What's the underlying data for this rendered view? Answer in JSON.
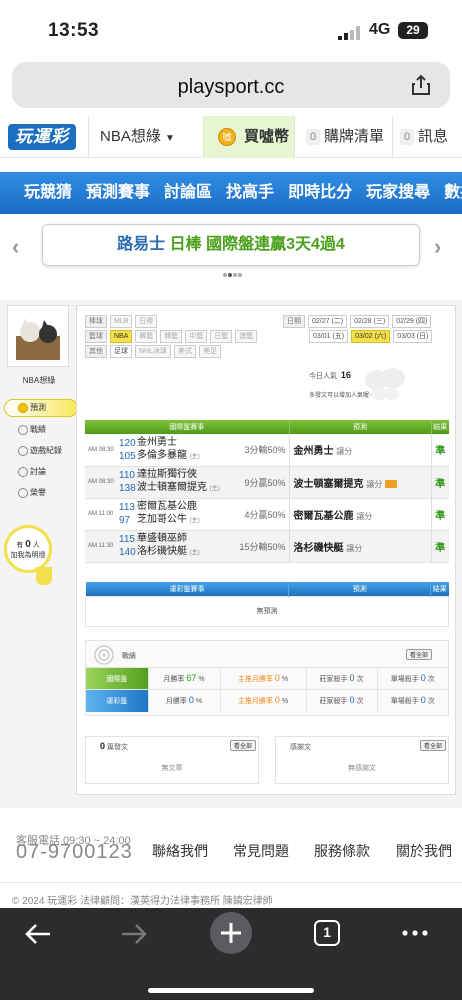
{
  "status": {
    "time": "13:53",
    "network": "4G",
    "battery": "29"
  },
  "browser": {
    "host": "playsport.cc",
    "tab_count": "1"
  },
  "nav1": {
    "logo": "玩運彩",
    "channel": "NBA想綠",
    "coin": "買噓幣",
    "buy_list": "購牌清單",
    "messages": "訊息",
    "buy_count": "0",
    "msg_count": "0"
  },
  "nav2": {
    "items": [
      "玩競猜",
      "預測賽事",
      "討論區",
      "找高手",
      "即時比分",
      "玩家搜尋",
      "數據"
    ]
  },
  "banner": {
    "part1": "路易士",
    "part2": "日棒",
    "part3": "國際盤連贏3天4過4"
  },
  "sidebar": {
    "name": "NBA想綠",
    "menu": [
      "預測",
      "戰績",
      "遊戲紀錄",
      "討論",
      "榮譽"
    ],
    "like_prefix": "有",
    "like_count": "0",
    "like_suffix": "人",
    "like_line2": "加我為明燈"
  },
  "filters": {
    "label_ball": "棒球",
    "label_basket": "籃球",
    "label_other": "其他",
    "label_date": "日期",
    "ball": [
      "MLB",
      "日棒"
    ],
    "basket": [
      "NBA",
      "韓籃",
      "韓籃",
      "中籃",
      "日籃",
      "澳籃"
    ],
    "other": [
      "足球",
      "NHL冰球",
      "美式",
      "美足"
    ],
    "dates1": [
      "02/27 (二)",
      "02/28 (三)",
      "02/29 (四)"
    ],
    "dates2": [
      "03/01 (五)",
      "03/02 (六)",
      "03/03 (日)"
    ],
    "today_label": "今日人氣",
    "today_count": "16",
    "note": "多發文可以增加人氣喔~"
  },
  "table": {
    "h_game": "國際盤賽事",
    "h_pred": "預測",
    "h_res": "結果",
    "rows": [
      {
        "time": "AM 08:30",
        "n1": "120",
        "t1": "金州勇士",
        "n2": "105",
        "t2": "多倫多暴龍",
        "t2tag": "(主)",
        "odds": "3分輸50%",
        "pred": "金州勇士",
        "ptype": "讓分",
        "res": "準"
      },
      {
        "time": "AM 08:30",
        "n1": "110",
        "t1": "達拉斯獨行俠",
        "n2": "138",
        "t2": "波士頓塞爾提克",
        "t2tag": "(主)",
        "odds": "9分贏50%",
        "pred": "波士頓塞爾提克",
        "ptype": "讓分",
        "res": "準"
      },
      {
        "time": "AM 11:00",
        "n1": "113",
        "t1": "密爾瓦基公鹿",
        "n2": "97",
        "t2": "芝加哥公牛",
        "t2tag": "(主)",
        "odds": "4分贏50%",
        "pred": "密爾瓦基公鹿",
        "ptype": "讓分",
        "res": "準"
      },
      {
        "time": "AM 11:30",
        "n1": "115",
        "t1": "華盛頓巫師",
        "n2": "140",
        "t2": "洛杉磯快艇",
        "t2tag": "(主)",
        "odds": "15分輸50%",
        "pred": "洛杉磯快艇",
        "ptype": "讓分",
        "res": "準"
      }
    ],
    "b_game": "運彩盤賽事",
    "b_pred": "預測",
    "b_res": "結果",
    "b_none": "無預測"
  },
  "stats": {
    "title": "戰績",
    "view_all": "看全部",
    "rows": [
      {
        "label": "國際盤",
        "m_label": "月勝率",
        "m_val": "67",
        "m_unit": "%",
        "h_label": "主推月勝率",
        "h_val": "0",
        "h_unit": "%",
        "z_label": "莊家殺手",
        "z_val": "0",
        "z_unit": "次",
        "s_label": "單場殺手",
        "s_val": "0",
        "s_unit": "次"
      },
      {
        "label": "運彩盤",
        "m_label": "月勝率",
        "m_val": "0",
        "m_unit": "%",
        "h_label": "主推月勝率",
        "h_val": "0",
        "h_unit": "%",
        "z_label": "莊家殺手",
        "z_val": "0",
        "z_unit": "次",
        "s_label": "單場殺手",
        "s_val": "0",
        "s_unit": "次"
      }
    ]
  },
  "posts": {
    "count": "0",
    "label": "篇發文",
    "view_all": "看全部",
    "empty": "無文章",
    "reply_label": "感謝文",
    "reply_view": "看全部",
    "reply_empty": "無感謝文"
  },
  "footer": {
    "tel_label": "客服電話 09:30 ~ 24:00",
    "tel": "07-9700123",
    "links": [
      "聯絡我們",
      "常見問題",
      "服務條款",
      "關於我們"
    ],
    "copy": "© 2024 玩運彩 法律顧問：漢英得力法律事務所 陳鎮宏律師"
  }
}
